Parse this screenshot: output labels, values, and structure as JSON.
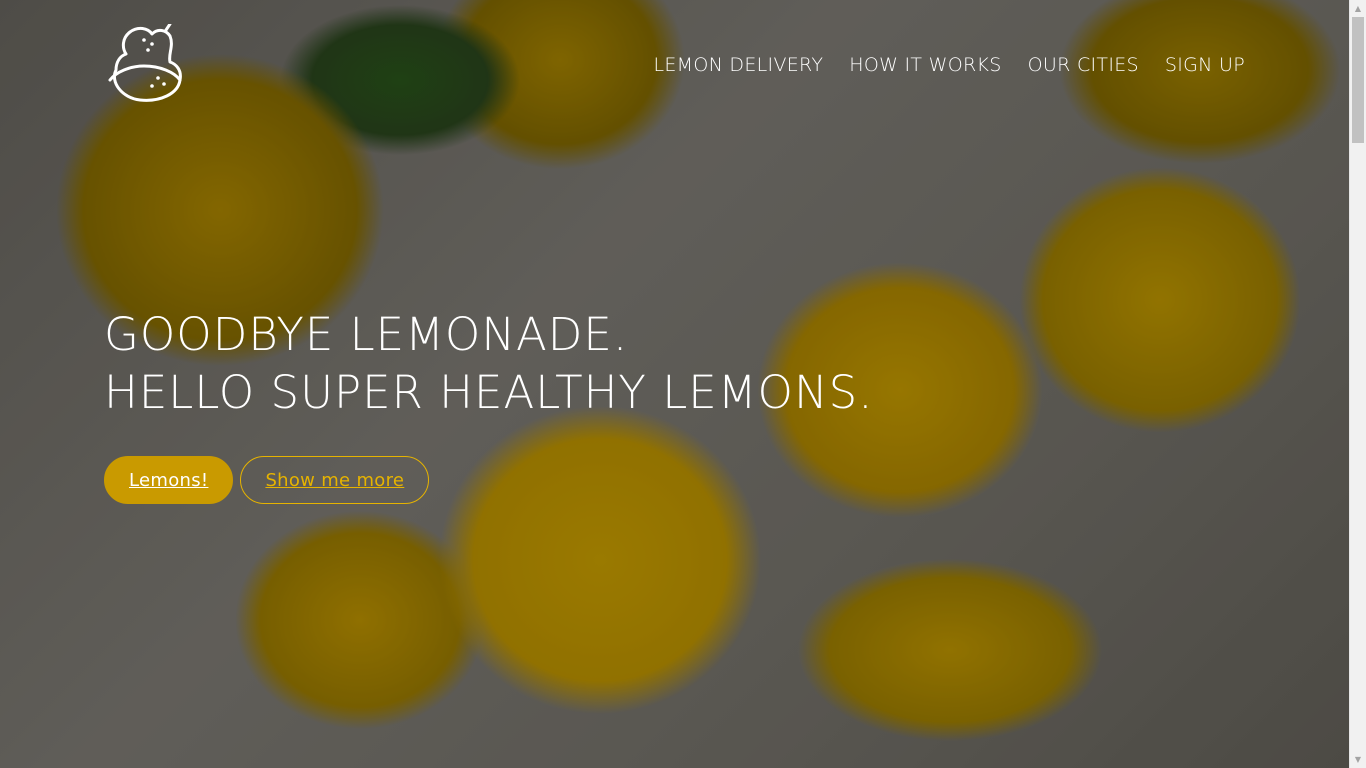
{
  "brand": {
    "logo_icon": "lemon-icon",
    "colors": {
      "accent": "#c99a00",
      "accent_outline": "#e6b300",
      "text": "#ffffff"
    }
  },
  "nav": {
    "items": [
      {
        "label": "LEMON DELIVERY"
      },
      {
        "label": "HOW IT WORKS"
      },
      {
        "label": "OUR CITIES"
      },
      {
        "label": "SIGN UP"
      }
    ]
  },
  "hero": {
    "headline_line1": "GOODBYE LEMONADE.",
    "headline_line2": "HELLO SUPER HEALTHY LEMONS.",
    "primary_button": "Lemons!",
    "secondary_button": "Show me more"
  },
  "scrollbar": {
    "up_icon": "scroll-up-arrow-icon",
    "down_icon": "scroll-down-arrow-icon"
  }
}
